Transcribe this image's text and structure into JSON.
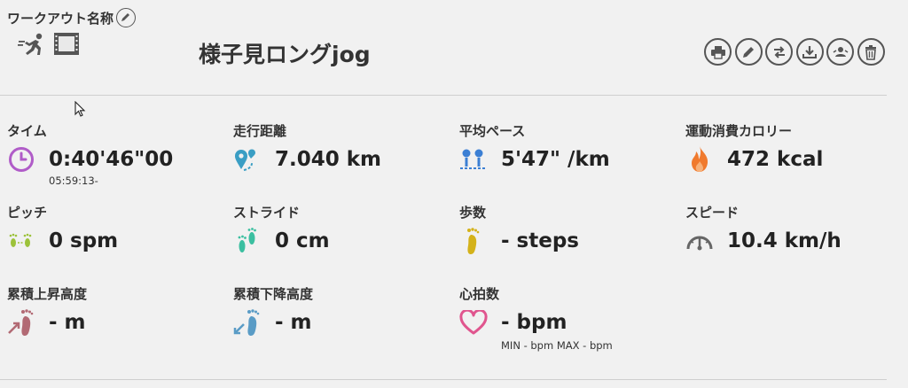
{
  "header": {
    "name_label": "ワークアウト名称",
    "title": "様子見ロングjog",
    "icons": [
      "pencil-icon",
      "runner-icon",
      "film-icon"
    ]
  },
  "toolbar": {
    "buttons": [
      "print-icon",
      "edit-icon",
      "swap-icon",
      "download-icon",
      "share-icon",
      "trash-icon"
    ]
  },
  "metrics": {
    "time": {
      "label": "タイム",
      "value": "0:40'46\"00",
      "sub": "05:59:13-",
      "icon": "clock-icon",
      "color": "#b05cc8"
    },
    "distance": {
      "label": "走行距離",
      "value": "7.040 km",
      "icon": "map-pin-icon",
      "color": "#3a9ec4"
    },
    "pace": {
      "label": "平均ペース",
      "value": "5'47\" /km",
      "icon": "pace-icon",
      "color": "#3b7fd4"
    },
    "calories": {
      "label": "運動消費カロリー",
      "value": "472 kcal",
      "icon": "flame-icon",
      "color": "#f07a2e"
    },
    "pitch": {
      "label": "ピッチ",
      "value": "0 spm",
      "icon": "footsteps-icon",
      "color": "#9cc23a"
    },
    "stride": {
      "label": "ストライド",
      "value": "0 cm",
      "icon": "footprints-icon",
      "color": "#3bbfa0"
    },
    "steps": {
      "label": "歩数",
      "value": "- steps",
      "icon": "footprint-icon",
      "color": "#d4b21a"
    },
    "speed": {
      "label": "スピード",
      "value": "10.4 km/h",
      "icon": "speedometer-icon",
      "color": "#666666"
    },
    "ascent": {
      "label": "累積上昇高度",
      "value": "- m",
      "icon": "ascent-icon",
      "color": "#b26a74"
    },
    "descent": {
      "label": "累積下降高度",
      "value": "- m",
      "icon": "descent-icon",
      "color": "#5a9cc6"
    },
    "heart": {
      "label": "心拍数",
      "value": "- bpm",
      "sub": "MIN - bpm MAX - bpm",
      "icon": "heart-icon",
      "color": "#e0558e"
    }
  }
}
